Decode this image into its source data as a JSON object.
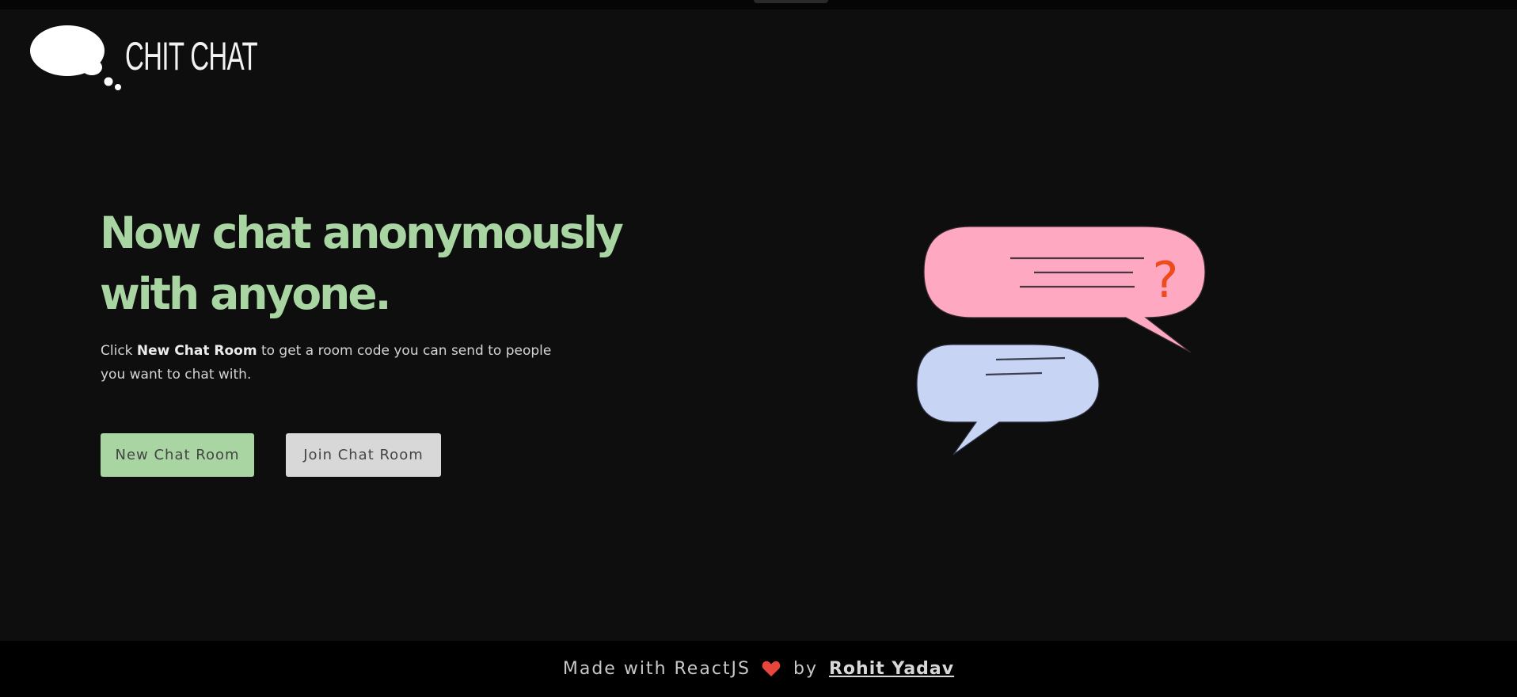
{
  "header": {
    "logo_icon": "thought-bubble-icon",
    "brand": "CHIT CHAT"
  },
  "hero": {
    "title": "Now chat anonymously with anyone.",
    "description_prefix": "Click ",
    "description_bold": "New Chat Room",
    "description_suffix": " to get a room code you can send to people you want to chat with."
  },
  "buttons": {
    "new_chat": "New Chat Room",
    "join_chat": "Join Chat Room"
  },
  "illustration": {
    "icon": "chat-bubbles-icon",
    "question_mark": "?"
  },
  "footer": {
    "made_with": "Made with ReactJS",
    "heart_icon": "heart-icon",
    "by": "by",
    "author": "Rohit Yadav"
  },
  "colors": {
    "background": "#0e0e0e",
    "accent_green": "#a8d5a2",
    "bubble_pink": "#ffa8c2",
    "bubble_blue": "#c8d4f4",
    "question_orange": "#ee4a1c",
    "heart_red": "#e8453c"
  }
}
